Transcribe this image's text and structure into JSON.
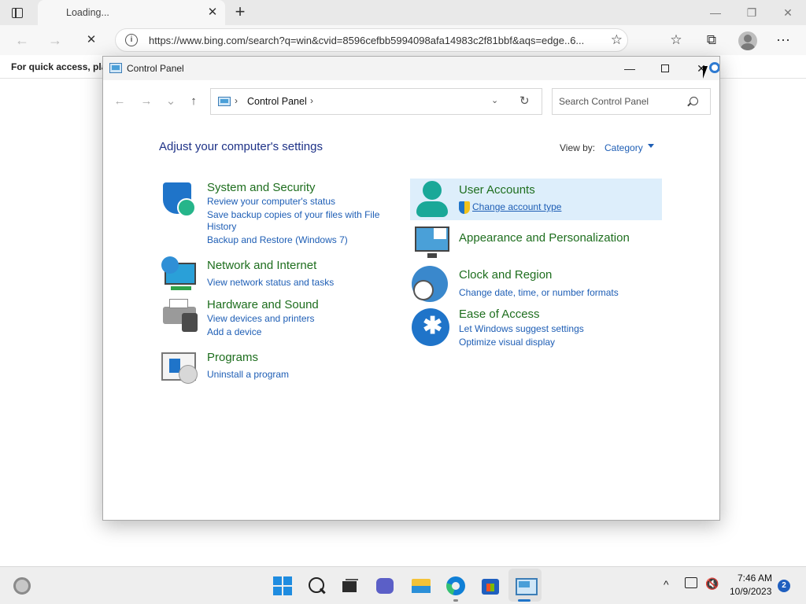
{
  "browser": {
    "tab_title": "Loading...",
    "tab_close": "✕",
    "new_tab": "+",
    "url": "https://www.bing.com/search?q=win&cvid=8596cefbb5994098afa14983c2f81bbf&aqs=edge..6...",
    "favorites_hint": "For quick access, plac",
    "window_controls": {
      "minimize": "—",
      "restore": "❐",
      "close": "✕"
    },
    "nav": {
      "back": "←",
      "forward": "→",
      "stop": "✕"
    },
    "toolbar_icons": [
      "add-favorite-icon",
      "favorites-icon",
      "collections-icon",
      "profile-icon",
      "more-icon"
    ],
    "toolbar_glyphs": {
      "add_favorite": "☆",
      "favorites": "☆",
      "collections": "⧉",
      "more": "⋯"
    }
  },
  "control_panel": {
    "title": "Control Panel",
    "window_controls": {
      "minimize": "—",
      "close": "✕"
    },
    "nav": {
      "back": "←",
      "forward": "→",
      "recent": "⌄",
      "up": "↑"
    },
    "breadcrumb": {
      "label": "Control Panel",
      "separator": "›",
      "dropdown": "⌄",
      "refresh": "↻"
    },
    "search_placeholder": "Search Control Panel",
    "heading": "Adjust your computer's settings",
    "view_by_label": "View by:",
    "view_by_value": "Category",
    "categories": {
      "system_security": {
        "title": "System and Security",
        "links": [
          "Review your computer's status",
          "Save backup copies of your files with File History",
          "Backup and Restore (Windows 7)"
        ]
      },
      "network": {
        "title": "Network and Internet",
        "links": [
          "View network status and tasks"
        ]
      },
      "hardware": {
        "title": "Hardware and Sound",
        "links": [
          "View devices and printers",
          "Add a device"
        ]
      },
      "programs": {
        "title": "Programs",
        "links": [
          "Uninstall a program"
        ]
      },
      "user_accounts": {
        "title": "User Accounts",
        "links": [
          "Change account type"
        ]
      },
      "appearance": {
        "title": "Appearance and Personalization",
        "links": []
      },
      "clock": {
        "title": "Clock and Region",
        "links": [
          "Change date, time, or number formats"
        ]
      },
      "ease": {
        "title": "Ease of Access",
        "links": [
          "Let Windows suggest settings",
          "Optimize visual display"
        ]
      }
    }
  },
  "taskbar": {
    "time": "7:46 AM",
    "date": "10/9/2023",
    "notification_count": "2",
    "tray_chevron": "^",
    "apps": [
      "start-icon",
      "search-icon",
      "task-view-icon",
      "teams-icon",
      "file-explorer-icon",
      "edge-icon",
      "store-icon",
      "control-panel-icon"
    ]
  },
  "colors": {
    "category_title": "#1e6e1e",
    "link": "#1e5eb5",
    "heading": "#1e3287",
    "highlight": "#ddeefb"
  }
}
